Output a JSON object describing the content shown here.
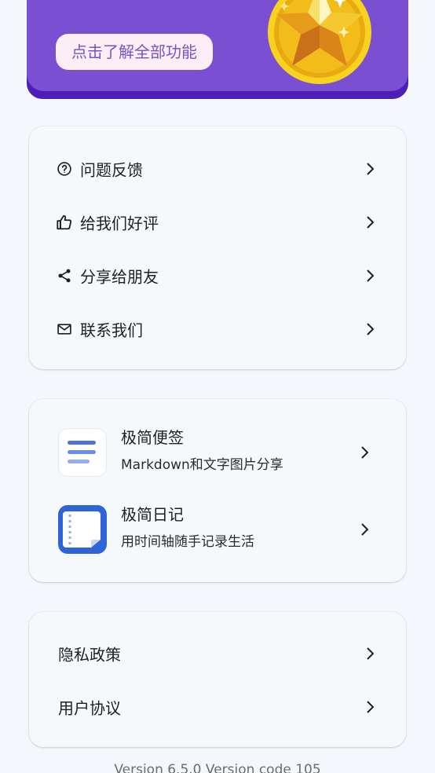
{
  "banner": {
    "button_label": "点击了解全部功能",
    "medal_icon": "star-medal-icon",
    "colors": {
      "banner": "#7b4fd1",
      "banner_edge": "#4c1fb6",
      "button_bg": "#fbeef4",
      "button_text": "#7a52c9"
    }
  },
  "support": {
    "items": [
      {
        "label": "问题反馈",
        "icon": "help-circle-icon"
      },
      {
        "label": "给我们好评",
        "icon": "thumbs-up-icon"
      },
      {
        "label": "分享给朋友",
        "icon": "share-icon"
      },
      {
        "label": "联系我们",
        "icon": "mail-icon"
      }
    ]
  },
  "apps": {
    "items": [
      {
        "name": "极简便签",
        "desc": "Markdown和文字图片分享",
        "icon": "notes-app-icon"
      },
      {
        "name": "极简日记",
        "desc": "用时间轴随手记录生活",
        "icon": "diary-app-icon"
      }
    ]
  },
  "legal": {
    "items": [
      {
        "label": "隐私政策"
      },
      {
        "label": "用户协议"
      }
    ]
  },
  "footer": {
    "version_text": "Version 6.5.0 Version code 105"
  }
}
